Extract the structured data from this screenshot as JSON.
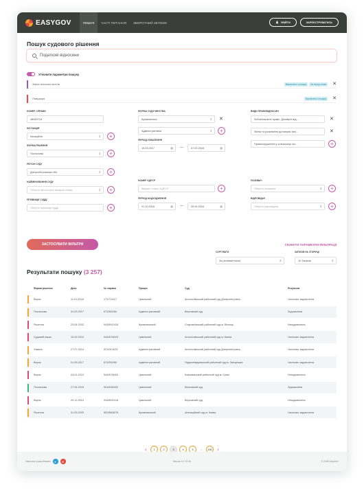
{
  "brand": "EASYGOV",
  "nav": [
    "ПОШУК",
    "ЧАСТІ ПИТАННЯ",
    "ЗВОРОТНИЙ ЗВ'ЯЗОК"
  ],
  "auth": {
    "login": "УВІЙТИ",
    "register": "ЗАРЕЄСТРУВАТИСЬ"
  },
  "page_title": "Пошук судового рішення",
  "search_value": "Податкові відносини",
  "refine_label": "Уточнити параметри пошуку",
  "chips": [
    {
      "text": "Зміна  алісника  житла",
      "color": "#9b59b6",
      "tags": [
        "Виключено з пошуку",
        "Хв серед слова"
      ]
    },
    {
      "text": "Ліквідація",
      "color": "#e24a4a",
      "tags": [
        "Виключено з пошуку"
      ]
    }
  ],
  "filters": {
    "case_no_label": "НОМЕР СПРАВИ",
    "case_no": "48060718",
    "instance_label": "ІНСТАНЦІЯ",
    "instance": "Касаційна",
    "decision_form_label": "ФОРМА РІШЕННЯ",
    "decision_form": "Постанова",
    "court_region_label": "РЕГІОН СУДУ",
    "court_region": "Дніпропетровська обл.",
    "court_name_label": "НАЙМЕНУВАННЯ СУДУ",
    "court_name_ph": "Оберіть або почніть вводити назву...",
    "judge_label": "ПРІЗВИЩЕ СУДДІ",
    "judge_ph": "Оберіть прізвище судді",
    "proc_form_label": "ФОРМА СУДОЧИНСТВА",
    "proc_form_1": "Кримінальна",
    "proc_form_2": "Адміністративна",
    "review_period_label": "ПЕРІОД УХВАЛЕННЯ",
    "review_from": "15.03.2017",
    "review_to": "07.02.2018",
    "edrsr_label": "НОМЕР ЄДРСР",
    "edrsr_ph": "Введіть номер ЄДРСР",
    "receipt_period_label": "ПЕРІОД НАДХОДЖЕННЯ",
    "receipt_from": "01.10.2016",
    "receipt_to": "20.04.2016",
    "legal_types_label": "ВИДИ ПРАВОВІДНОСИН",
    "legal_1": "Зобов'язальне право. Договірні від...",
    "legal_2": "Зміна та розірвання договорів, виз...",
    "legal_3": "Правопорушення у сільському гос...",
    "plaintiff_label": "ПОЗИВАЧ",
    "plaintiff_ph": "Оберіть позивача",
    "defendant_label": "ВІДПОВІДАЧ",
    "defendant_ph": "Оберіть відповідача"
  },
  "apply_btn": "ЗАСТОСУВАТИ ФІЛЬТРИ",
  "reset_btn": "СКИНУТИ ПАРАМЕТРИ ФІЛЬТРАЦІЇ",
  "results": {
    "title": "Результати пошуку",
    "count": "(3 257)",
    "sort_label": "СОРТУВАТИ",
    "sort_value": "За релевантністю",
    "per_page_label": "ЗАПИСІВ НА СТОРІНЦІ",
    "per_page_value": "10 Записів",
    "columns": [
      "Форма рішення",
      "Дата",
      "№ справи",
      "Процес",
      "Суд",
      "Результат"
    ],
    "rows": [
      {
        "form": "Вирок",
        "date": "11.01.2018",
        "no": "171/724/17",
        "process": "Цивільний",
        "court": "Апостолівський районний суд Дніпропетровсь...",
        "result": "Частково задоволена",
        "color": "#f0a830"
      },
      {
        "form": "Постанова",
        "date": "31.03.2017",
        "no": "672/552/84",
        "process": "Адміністративний",
        "court": "Верховний суд",
        "result": "Задоволена",
        "color": "#f0a830"
      },
      {
        "form": "Рішення",
        "date": "23.04.2002",
        "no": "943/8910/18",
        "process": "Кримінальний",
        "court": "Старокиївський районний суд м. Вінниці",
        "result": "Незадоволена",
        "color": "#e24a6a"
      },
      {
        "form": "Судовий наказ",
        "date": "19.02.2014",
        "no": "544/8766/03",
        "process": "Цивільний",
        "court": "Апостолівський районний суд м. Києва",
        "result": "Частково задоволена",
        "color": "#e24a6a"
      },
      {
        "form": "Ухвала",
        "date": "27.07.2014",
        "no": "921/00-6/23",
        "process": "Адміністративний",
        "court": "Апостолівський районний суд Дніпропетровсь...",
        "result": "Частково задоволена",
        "color": "#f0a830"
      },
      {
        "form": "Вирок",
        "date": "01.05.2017",
        "no": "672/552/84",
        "process": "Адміністративний",
        "court": "Орджонікідзевський районний суд м. Запоріжжя",
        "result": "Частково задоволена",
        "color": "#f0a830"
      },
      {
        "form": "Вирок",
        "date": "03.01.2010",
        "no": "544/8766/03",
        "process": "Цивільний",
        "court": "Ковпаківський районний суд м. Суми",
        "result": "Незадоволена",
        "color": "#e24a6a"
      },
      {
        "form": "Постанова",
        "date": "27.04.2018",
        "no": "901/6364/02",
        "process": "Цивільний",
        "court": "Верховний суд",
        "result": "Задоволена",
        "color": "#3cb878"
      },
      {
        "form": "Вирок",
        "date": "20.12.2013",
        "no": "943/8910/18",
        "process": "Цивільний",
        "court": "Верховний суд",
        "result": "Незадоволена",
        "color": "#e24a6a"
      },
      {
        "form": "Рішення",
        "date": "01.05.2003",
        "no": "802/88087/5",
        "process": "Кримінальний",
        "court": "Апеляційний суд м. Києва",
        "result": "Частково задоволена",
        "color": "#f0a830"
      }
    ]
  },
  "pagination": [
    "1",
    "2",
    "3",
    "4",
    "5",
    "...",
    "150"
  ],
  "footer": {
    "dev": "Написати розробникам",
    "version": "Версія 1.0.12.46",
    "copyright": "© 2018 EasyGov"
  }
}
